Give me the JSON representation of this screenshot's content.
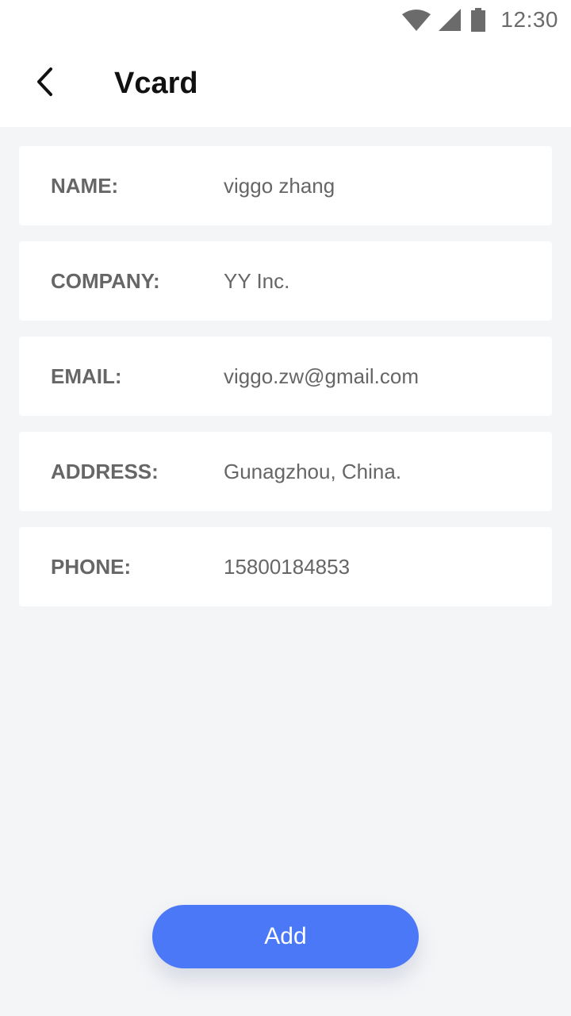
{
  "status_bar": {
    "time": "12:30",
    "icons": [
      "wifi-icon",
      "signal-icon",
      "battery-icon"
    ]
  },
  "header": {
    "title": "Vcard",
    "back_icon": "chevron-left-icon"
  },
  "fields": [
    {
      "label": "NAME:",
      "value": "viggo zhang"
    },
    {
      "label": "COMPANY:",
      "value": "YY Inc."
    },
    {
      "label": "EMAIL:",
      "value": "viggo.zw@gmail.com"
    },
    {
      "label": "ADDRESS:",
      "value": "Gunagzhou, China."
    },
    {
      "label": "PHONE:",
      "value": "15800184853"
    }
  ],
  "actions": {
    "add_label": "Add"
  },
  "colors": {
    "accent": "#4a78f6",
    "background": "#f4f5f7",
    "card": "#ffffff",
    "text_secondary": "#666666"
  }
}
